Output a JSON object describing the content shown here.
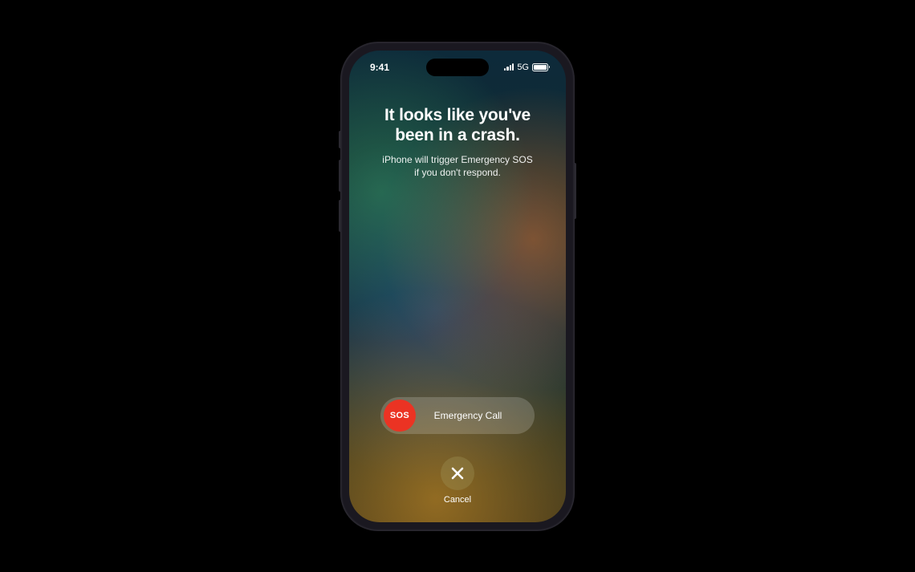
{
  "status_bar": {
    "time": "9:41",
    "network": "5G"
  },
  "alert": {
    "headline_line1": "It looks like you've",
    "headline_line2": "been in a crash.",
    "subhead_line1": "iPhone will trigger Emergency SOS",
    "subhead_line2": "if you don't respond."
  },
  "slider": {
    "knob_label": "SOS",
    "track_label": "Emergency Call"
  },
  "cancel": {
    "label": "Cancel"
  },
  "colors": {
    "sos_red": "#eb3323"
  }
}
